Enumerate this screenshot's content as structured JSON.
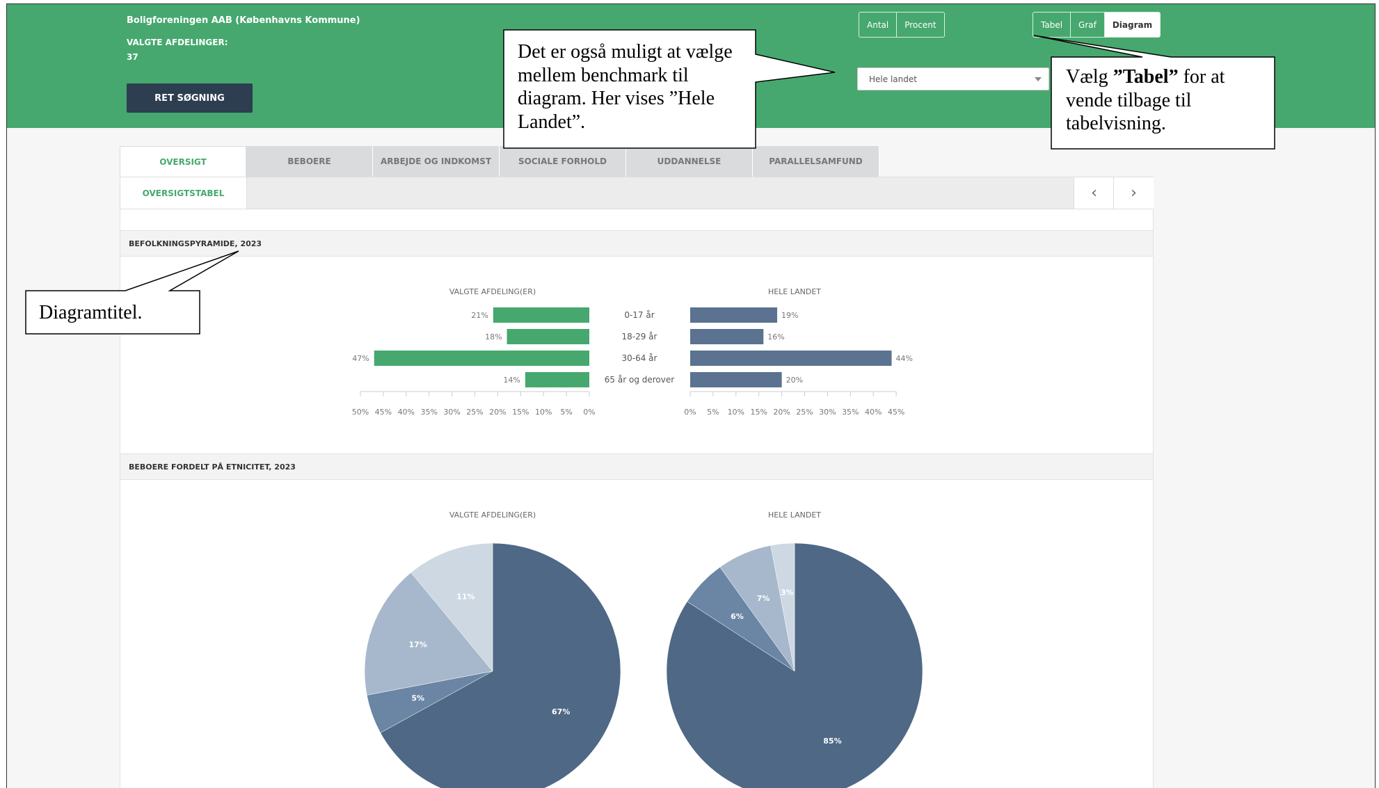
{
  "header": {
    "org_title": "Boligforeningen AAB (Københavns Kommune)",
    "selected_label": "VALGTE AFDELINGER:",
    "selected_count": "37",
    "search_button": "RET SØGNING",
    "unit_toggle": [
      "Antal",
      "Procent"
    ],
    "view_toggle": [
      "Tabel",
      "Graf",
      "Diagram"
    ],
    "view_active": "Diagram",
    "benchmark_selected": "Hele landet"
  },
  "tabs": [
    "OVERSIGT",
    "BEBOERE",
    "ARBEJDE OG INDKOMST",
    "SOCIALE FORHOLD",
    "UDDANNELSE",
    "PARALLELSAMFUND"
  ],
  "subtab": "OVERSIGTSTABEL",
  "sections": {
    "pyramid_title": "BEFOLKNINGSPYRAMIDE, 2023",
    "ethnicity_title": "BEBOERE FORDELT PÅ ETNICITET, 2023"
  },
  "callouts": {
    "benchmark_note": "Det er også muligt at vælge mellem benchmark til diagram. Her vises ”Hele Landet”.",
    "tabel_prefix": "Vælg ",
    "tabel_bold": "”Tabel”",
    "tabel_suffix": " for at vende tilbage til tabelvisning.",
    "title_note": "Diagramtitel."
  },
  "colors": {
    "green": "#46a86e",
    "navy": "#2c3e50",
    "slate": "#5b7290"
  },
  "chart_data": [
    {
      "type": "bar",
      "title": "BEFOLKNINGSPYRAMIDE, 2023",
      "categories": [
        "0-17 år",
        "18-29 år",
        "30-64 år",
        "65 år og derover"
      ],
      "series": [
        {
          "name": "VALGTE AFDELING(ER)",
          "values": [
            21,
            18,
            47,
            14
          ],
          "labels": [
            "21%",
            "18%",
            "47%",
            "14%"
          ],
          "color": "#46a86e"
        },
        {
          "name": "HELE LANDET",
          "values": [
            19,
            16,
            44,
            20
          ],
          "labels": [
            "19%",
            "16%",
            "44%",
            "20%"
          ],
          "color": "#5b7290"
        }
      ],
      "left_ticks": [
        "50%",
        "45%",
        "40%",
        "35%",
        "30%",
        "25%",
        "20%",
        "15%",
        "10%",
        "5%",
        "0%"
      ],
      "right_ticks": [
        "0%",
        "5%",
        "10%",
        "15%",
        "20%",
        "25%",
        "30%",
        "35%",
        "40%",
        "45%"
      ]
    },
    {
      "type": "pie",
      "title": "BEBOERE FORDELT PÅ ETNICITET, 2023",
      "pies": [
        {
          "name": "VALGTE AFDELING(ER)",
          "values": [
            67,
            5,
            17,
            11
          ],
          "labels": [
            "67%",
            "5%",
            "17%",
            "11%"
          ]
        },
        {
          "name": "HELE LANDET",
          "values": [
            85,
            6,
            7,
            3
          ],
          "labels": [
            "85%",
            "6%",
            "7%",
            "3%"
          ]
        }
      ],
      "slice_colors": [
        "#4e6885",
        "#6a86a4",
        "#a7b8cc",
        "#cdd8e3"
      ]
    }
  ]
}
